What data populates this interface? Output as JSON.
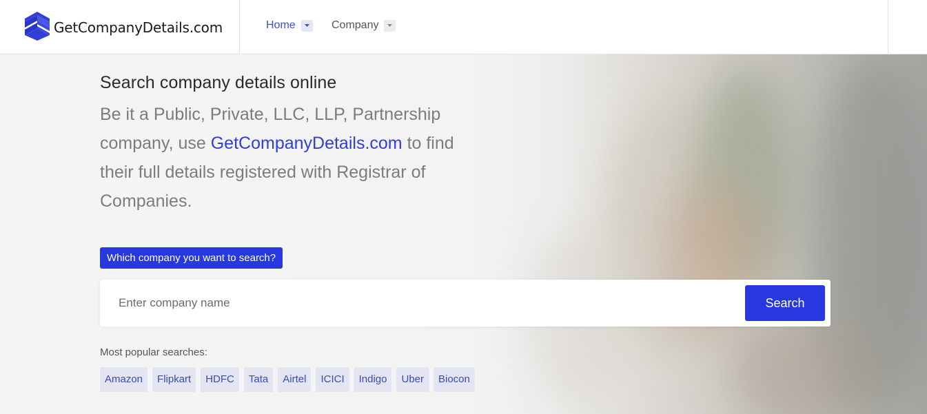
{
  "header": {
    "brand_name": "GetCompanyDetails.com",
    "nav": [
      {
        "label": "Home"
      },
      {
        "label": "Company"
      }
    ]
  },
  "hero": {
    "title": "Search company details online",
    "subtitle_before": "Be it a Public, Private, LLC, LLP, Partnership company, use ",
    "subtitle_link": "GetCompanyDetails.com",
    "subtitle_after": " to find their full details registered with Registrar of Companies."
  },
  "search": {
    "question": "Which company you want to search?",
    "placeholder": "Enter company name",
    "value": "",
    "button_label": "Search"
  },
  "popular": {
    "label": "Most popular searches:",
    "tags": [
      "Amazon",
      "Flipkart",
      "HDFC",
      "Tata",
      "Airtel",
      "ICICI",
      "Indigo",
      "Uber",
      "Biocon"
    ]
  },
  "colors": {
    "accent": "#2838e0",
    "nav_active": "#3d4fd6",
    "tag_bg": "#e3e5f3",
    "tag_text": "#3d4ab4"
  },
  "icons": {
    "logo": "cube-logo-icon",
    "caret": "caret-down-icon"
  }
}
